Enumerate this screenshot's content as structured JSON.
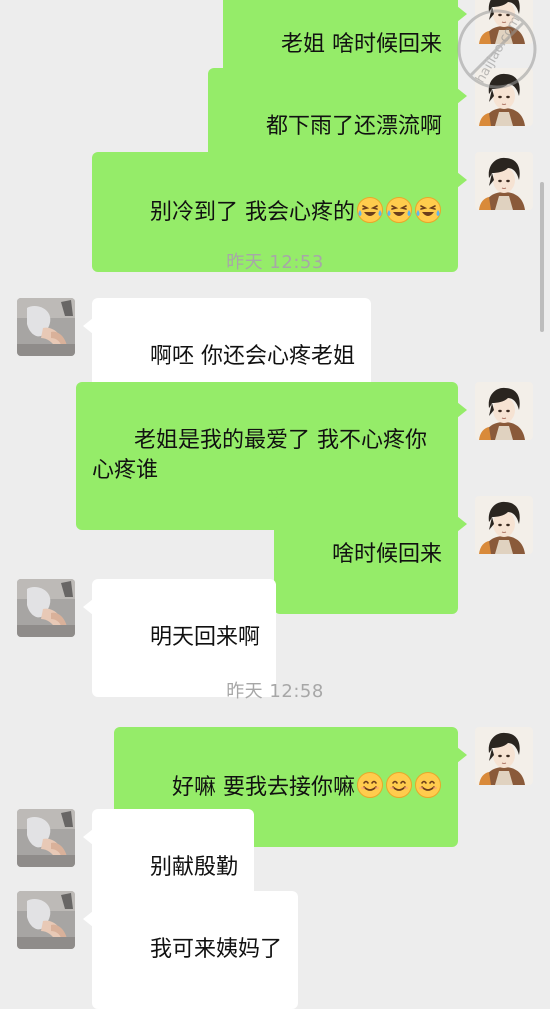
{
  "messages": [
    {
      "side": "out",
      "text": "老姐 啥时候回来",
      "emoji": 0
    },
    {
      "side": "out",
      "text": "都下雨了还漂流啊",
      "emoji": 0
    },
    {
      "side": "out",
      "text": "别冷到了 我会心疼的",
      "emoji": 3,
      "emoji_type": "crying-laughing"
    },
    {
      "side": "time",
      "text": "昨天 12:53"
    },
    {
      "side": "in",
      "text": "啊呸 你还会心疼老姐",
      "emoji": 0
    },
    {
      "side": "out",
      "text": "老姐是我的最爱了 我不心疼你心疼谁",
      "emoji": 0
    },
    {
      "side": "out",
      "text": "啥时候回来",
      "emoji": 0
    },
    {
      "side": "in",
      "text": "明天回来啊",
      "emoji": 0
    },
    {
      "side": "time",
      "text": "昨天 12:58"
    },
    {
      "side": "out",
      "text": "好嘛 要我去接你嘛",
      "emoji": 3,
      "emoji_type": "smile"
    },
    {
      "side": "in",
      "text": "别献殷勤",
      "emoji": 0
    },
    {
      "side": "in",
      "text": "我可来姨妈了",
      "emoji": 0
    }
  ],
  "watermark": {
    "text": "haijiao.com"
  },
  "colors": {
    "background": "#ededed",
    "outgoing_bubble": "#95ec69",
    "incoming_bubble": "#ffffff",
    "timestamp_text": "#a7a7a7"
  }
}
